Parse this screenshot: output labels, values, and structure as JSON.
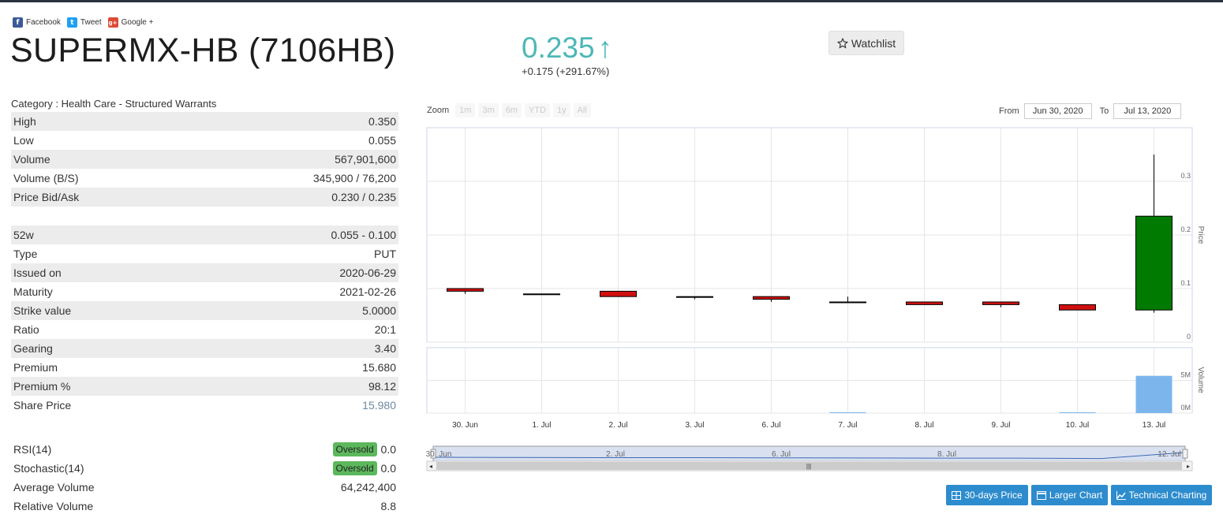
{
  "social": {
    "facebook": "Facebook",
    "tweet": "Tweet",
    "google": "Google +"
  },
  "stock": {
    "title": "SUPERMX-HB (7106HB)",
    "price": "0.235",
    "price_arrow": "↑",
    "change": "+0.175 (+291.67%)",
    "watchlist": "Watchlist",
    "category": "Category : Health Care - Structured Warrants"
  },
  "table1": [
    {
      "label": "High",
      "value": "0.350"
    },
    {
      "label": "Low",
      "value": "0.055"
    },
    {
      "label": "Volume",
      "value": "567,901,600"
    },
    {
      "label": "Volume (B/S)",
      "value": "345,900 / 76,200"
    },
    {
      "label": "Price Bid/Ask",
      "value": "0.230 / 0.235"
    }
  ],
  "table2": [
    {
      "label": "52w",
      "value": "0.055 - 0.100"
    },
    {
      "label": "Type",
      "value": "PUT"
    },
    {
      "label": "Issued on",
      "value": "2020-06-29"
    },
    {
      "label": "Maturity",
      "value": "2021-02-26"
    },
    {
      "label": "Strike value",
      "value": "5.0000"
    },
    {
      "label": "Ratio",
      "value": "20:1"
    },
    {
      "label": "Gearing",
      "value": "3.40"
    },
    {
      "label": "Premium",
      "value": "15.680"
    },
    {
      "label": "Premium %",
      "value": "98.12"
    },
    {
      "label": "Share Price",
      "value": "15.980"
    }
  ],
  "table3": [
    {
      "label": "RSI(14)",
      "badge": "Oversold",
      "value": "0.0"
    },
    {
      "label": "Stochastic(14)",
      "badge": "Oversold",
      "value": "0.0"
    },
    {
      "label": "Average Volume",
      "value": "64,242,400"
    },
    {
      "label": "Relative Volume",
      "value": "8.8"
    }
  ],
  "chart_controls": {
    "zoom_label": "Zoom",
    "zoom_buttons": [
      "1m",
      "3m",
      "6m",
      "YTD",
      "1y",
      "All"
    ],
    "from_label": "From",
    "from_value": "Jun 30, 2020",
    "to_label": "To",
    "to_value": "Jul 13, 2020"
  },
  "buttons": {
    "days30": "30-days Price",
    "larger": "Larger Chart",
    "technical": "Technical Charting"
  },
  "chart_data": {
    "type": "candlestick",
    "categories": [
      "30. Jun",
      "1. Jul",
      "2. Jul",
      "3. Jul",
      "6. Jul",
      "7. Jul",
      "8. Jul",
      "9. Jul",
      "10. Jul",
      "13. Jul"
    ],
    "ohlc": [
      {
        "open": 0.1,
        "high": 0.1,
        "low": 0.09,
        "close": 0.095,
        "color": "#d01010"
      },
      {
        "open": 0.09,
        "high": 0.09,
        "low": 0.09,
        "close": 0.09,
        "color": "#000000"
      },
      {
        "open": 0.095,
        "high": 0.095,
        "low": 0.085,
        "close": 0.085,
        "color": "#d01010"
      },
      {
        "open": 0.085,
        "high": 0.085,
        "low": 0.08,
        "close": 0.085,
        "color": "#000000"
      },
      {
        "open": 0.085,
        "high": 0.085,
        "low": 0.075,
        "close": 0.08,
        "color": "#d01010"
      },
      {
        "open": 0.075,
        "high": 0.085,
        "low": 0.075,
        "close": 0.075,
        "color": "#000000"
      },
      {
        "open": 0.075,
        "high": 0.075,
        "low": 0.07,
        "close": 0.07,
        "color": "#d01010"
      },
      {
        "open": 0.075,
        "high": 0.075,
        "low": 0.065,
        "close": 0.07,
        "color": "#d01010"
      },
      {
        "open": 0.07,
        "high": 0.07,
        "low": 0.06,
        "close": 0.06,
        "color": "#d01010"
      },
      {
        "open": 0.06,
        "high": 0.35,
        "low": 0.055,
        "close": 0.235,
        "color": "#007a00"
      }
    ],
    "volume": [
      0,
      0,
      0,
      0,
      0,
      0.05,
      0,
      0,
      0.05,
      5.7
    ],
    "volume_color": "#7cb5ec",
    "price_ticks": [
      "0",
      "0.1",
      "0.2",
      "0.3"
    ],
    "price_ylim": [
      0,
      0.4
    ],
    "volume_ticks": [
      "0M",
      "5M"
    ],
    "volume_ylim": [
      0,
      10
    ],
    "price_axis_label": "Price",
    "volume_axis_label": "Volume",
    "navigator_labels": [
      "30. Jun",
      "2. Jul",
      "6. Jul",
      "8. Jul",
      "12. Jul"
    ]
  }
}
